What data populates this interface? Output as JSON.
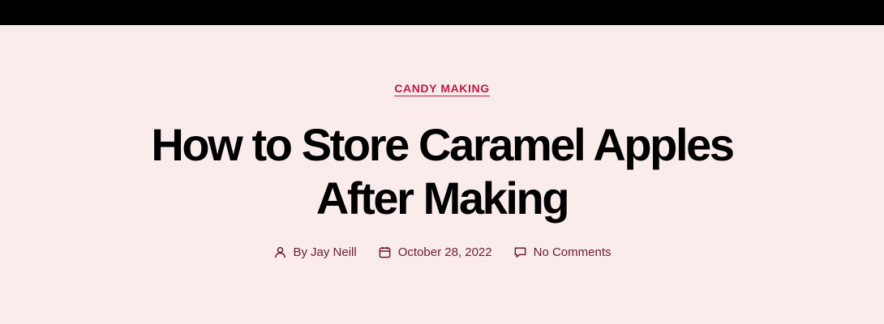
{
  "category": {
    "label": "CANDY MAKING"
  },
  "post": {
    "title_line1": "How to Store Caramel Apples",
    "title_line2": "After Making"
  },
  "meta": {
    "author_prefix": "By",
    "author": "Jay Neill",
    "date": "October 28, 2022",
    "comments": "No Comments"
  },
  "icons": {
    "author": "user-icon",
    "date": "calendar-icon",
    "comments": "comment-bubble-icon"
  },
  "colors": {
    "background": "#fbecec",
    "topbar": "#000000",
    "accent": "#c2183f",
    "meta_text": "#6d1b2c",
    "title": "#000000"
  }
}
